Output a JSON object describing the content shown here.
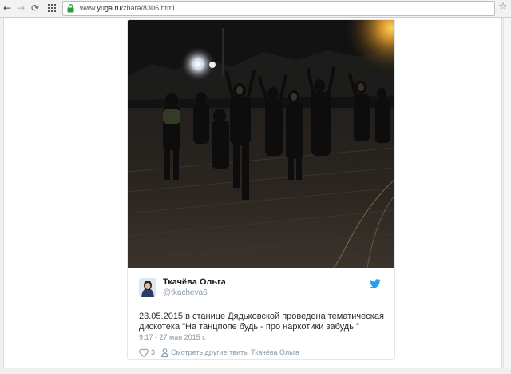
{
  "browser": {
    "url_prefix": "www.",
    "url_domain": "yuga.ru",
    "url_path": "/zhara/8306.html",
    "icons": {
      "back": "back-arrow-icon",
      "forward": "forward-arrow-icon",
      "reload": "reload-icon",
      "apps": "apps-icon",
      "secure": "lock-icon",
      "bookmark": "star-icon"
    },
    "secure_color": "#2e9b3e"
  },
  "tweet": {
    "photo_description_icon": "photo",
    "author_name": "Ткачёва Ольга",
    "author_handle": "@tkacheva6",
    "text_lines": [
      "23.05.2015 в станице Дядьковской  проведена  тематическая",
      "дискотека  \"На танцпопе будь - про наркотики забудь!\""
    ],
    "timestamp": "9:17 - 27 мая 2015 г.",
    "likes": "3",
    "more_tweets_link": "Смотреть другие твиты Ткачёва Ольга",
    "accent_color": "#1da1f2"
  }
}
